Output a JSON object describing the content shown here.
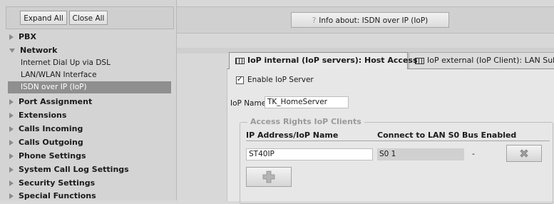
{
  "sidebar": {
    "expand_all": "Expand All",
    "close_all": "Close All",
    "items": [
      {
        "label": "PBX",
        "type": "category",
        "expanded": false
      },
      {
        "label": "Network",
        "type": "category",
        "expanded": true
      },
      {
        "label": "Internet Dial Up via DSL",
        "type": "sub"
      },
      {
        "label": "LAN/WLAN Interface",
        "type": "sub"
      },
      {
        "label": "ISDN over IP (IoP)",
        "type": "sub",
        "active": true
      },
      {
        "label": "Port Assignment",
        "type": "category",
        "expanded": false
      },
      {
        "label": "Extensions",
        "type": "category",
        "expanded": false
      },
      {
        "label": "Calls Incoming",
        "type": "category",
        "expanded": false
      },
      {
        "label": "Calls Outgoing",
        "type": "category",
        "expanded": false
      },
      {
        "label": "Phone Settings",
        "type": "category",
        "expanded": false
      },
      {
        "label": "System Call Log Settings",
        "type": "category",
        "expanded": false
      },
      {
        "label": "Security Settings",
        "type": "category",
        "expanded": false
      },
      {
        "label": "Special Functions",
        "type": "category",
        "expanded": false
      }
    ]
  },
  "header": {
    "info_icon": "?",
    "info_label": "Info about: ISDN over IP (IoP)"
  },
  "tabs": [
    {
      "label": "IoP internal (IoP servers): Host Access",
      "active": true,
      "icon": "table-icon"
    },
    {
      "label": "IoP external (IoP Client): LAN Sub PBX",
      "active": false,
      "icon": "table-icon"
    }
  ],
  "form": {
    "enable_iop_label": "Enable IoP Server",
    "enable_iop_checked": true,
    "iop_name_label": "IoP Name",
    "iop_name_value": "TK_HomeServer",
    "access_rights": {
      "legend": "Access Rights IoP Clients",
      "columns": [
        "IP Address/IoP Name",
        "Connect to LAN S0 Bus Enabled"
      ],
      "rows": [
        {
          "ip": "ST40IP",
          "bus": "S0 1",
          "enabled": "-"
        }
      ]
    }
  },
  "colors": {
    "active_nav_bg": "#8f8f8f",
    "panel_bg": "#e7e7e7",
    "delete_icon": "#a0a0a0",
    "add_icon": "#b4b4b4"
  }
}
